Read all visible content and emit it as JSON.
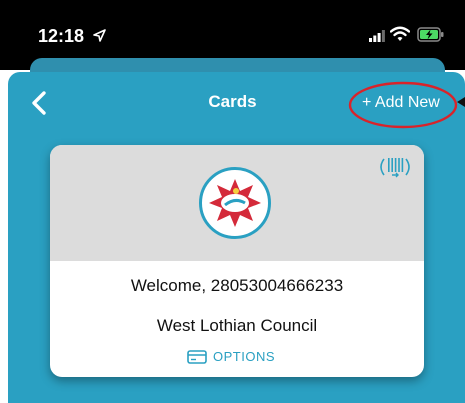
{
  "status_bar": {
    "time": "12:18",
    "icons": [
      "location-arrow-icon",
      "cellular-signal-icon",
      "wifi-icon",
      "battery-charging-icon"
    ]
  },
  "nav": {
    "title": "Cards",
    "back_icon": "chevron-left-icon",
    "add_new_label": "+ Add New"
  },
  "card": {
    "logo_icon": "boom-card-logo-icon",
    "contactless_icon": "contactless-icon",
    "welcome": "Welcome, 28053004666233",
    "council": "West Lothian Council",
    "options_icon": "card-icon",
    "options_label": "OPTIONS"
  },
  "annotation": {
    "highlight_color": "#d9232a",
    "shape": "ellipse"
  },
  "colors": {
    "accent": "#2aa0c2",
    "card_header": "#dcdcdc",
    "status_bar": "#000000"
  }
}
